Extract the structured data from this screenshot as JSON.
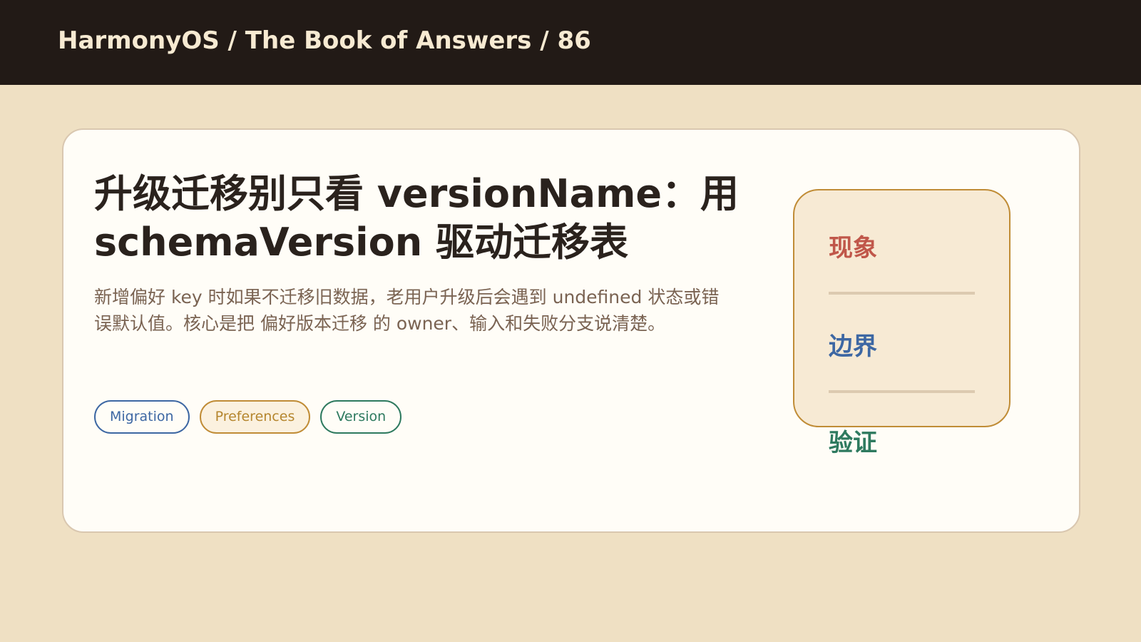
{
  "header": {
    "breadcrumb": "HarmonyOS / The Book of Answers / 86"
  },
  "card": {
    "title": "升级迁移别只看 versionName：用 schemaVersion 驱动迁移表",
    "summary": "新增偏好 key 时如果不迁移旧数据，老用户升级后会遇到 undefined 状态或错误默认值。核心是把 偏好版本迁移 的 owner、输入和失败分支说清楚。",
    "tags": [
      {
        "label": "Migration",
        "color": "#3d67a3"
      },
      {
        "label": "Preferences",
        "color": "#b5862e"
      },
      {
        "label": "Version",
        "color": "#2e7a5f"
      }
    ]
  },
  "side_panel": {
    "items": [
      {
        "label": "现象",
        "color": "#c0574a"
      },
      {
        "label": "边界",
        "color": "#3d67a3"
      },
      {
        "label": "验证",
        "color": "#2e7a5f"
      }
    ]
  }
}
